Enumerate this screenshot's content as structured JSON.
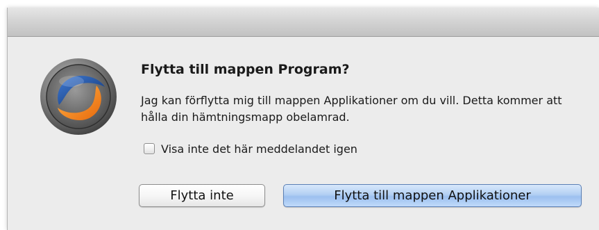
{
  "dialog": {
    "title": "Flytta till mappen Program?",
    "message": "Jag kan förflytta mig till mappen Applikationer om du vill. Detta kommer att hålla din hämtningsmapp obelamrad.",
    "checkbox": {
      "label": "Visa inte det här meddelandet igen",
      "checked": false
    },
    "buttons": {
      "secondary_label": "Flytta inte",
      "primary_label": "Flytta till mappen Applikationer"
    },
    "app_icon": "swirl-app-icon"
  },
  "colors": {
    "window_background": "#ececec",
    "primary_button": "#b3d0f3",
    "icon_orange": "#f08a1c",
    "icon_blue": "#1d4f9c"
  }
}
